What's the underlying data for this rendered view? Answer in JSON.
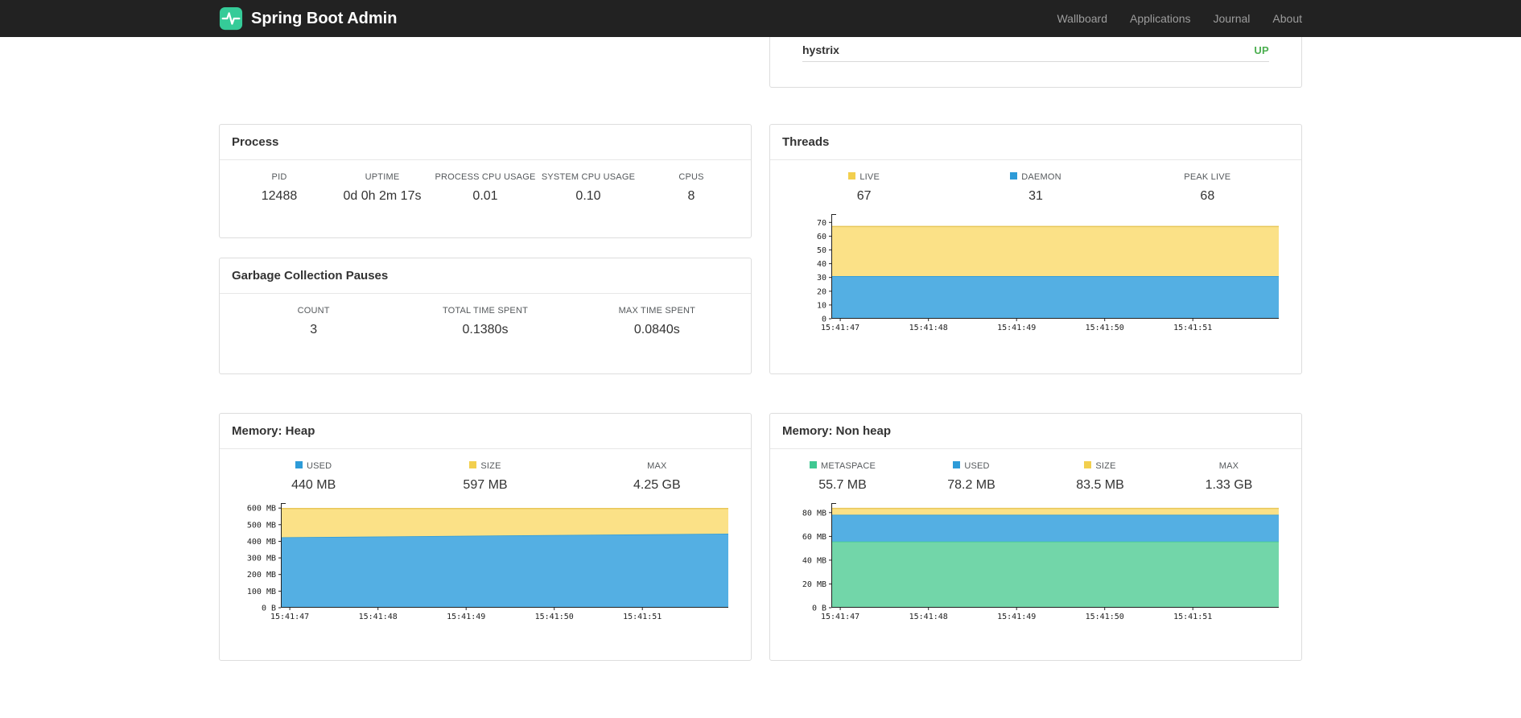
{
  "navbar": {
    "brand": "Spring Boot Admin",
    "links": [
      {
        "label": "Wallboard"
      },
      {
        "label": "Applications"
      },
      {
        "label": "Journal"
      },
      {
        "label": "About"
      }
    ]
  },
  "application_card": {
    "name": "hystrix",
    "status": "UP",
    "status_color": "#4caf50"
  },
  "process": {
    "title": "Process",
    "metrics": [
      {
        "label": "PID",
        "value": "12488"
      },
      {
        "label": "UPTIME",
        "value": "0d 0h 2m 17s"
      },
      {
        "label": "PROCESS CPU USAGE",
        "value": "0.01"
      },
      {
        "label": "SYSTEM CPU USAGE",
        "value": "0.10"
      },
      {
        "label": "CPUS",
        "value": "8"
      }
    ]
  },
  "gc": {
    "title": "Garbage Collection Pauses",
    "metrics": [
      {
        "label": "COUNT",
        "value": "3"
      },
      {
        "label": "TOTAL TIME SPENT",
        "value": "0.1380s"
      },
      {
        "label": "MAX TIME SPENT",
        "value": "0.0840s"
      }
    ]
  },
  "threads": {
    "title": "Threads",
    "legend": [
      {
        "label": "LIVE",
        "value": "67",
        "swatch": "#f2cf4e"
      },
      {
        "label": "DAEMON",
        "value": "31",
        "swatch": "#2d9bd8"
      },
      {
        "label": "PEAK LIVE",
        "value": "68",
        "swatch": null
      }
    ]
  },
  "heap": {
    "title": "Memory: Heap",
    "legend": [
      {
        "label": "USED",
        "value": "440 MB",
        "swatch": "#2d9bd8"
      },
      {
        "label": "SIZE",
        "value": "597 MB",
        "swatch": "#f2cf4e"
      },
      {
        "label": "MAX",
        "value": "4.25 GB",
        "swatch": null
      }
    ]
  },
  "nonheap": {
    "title": "Memory: Non heap",
    "legend": [
      {
        "label": "METASPACE",
        "value": "55.7 MB",
        "swatch": "#3fc892"
      },
      {
        "label": "USED",
        "value": "78.2 MB",
        "swatch": "#2d9bd8"
      },
      {
        "label": "SIZE",
        "value": "83.5 MB",
        "swatch": "#f2cf4e"
      },
      {
        "label": "MAX",
        "value": "1.33 GB",
        "swatch": null
      }
    ]
  },
  "chart_data": [
    {
      "id": "threads",
      "type": "area",
      "title": "Threads",
      "x": [
        "15:41:47",
        "15:41:48",
        "15:41:49",
        "15:41:50",
        "15:41:51"
      ],
      "ylim": [
        0,
        76
      ],
      "yticks": [
        {
          "v": 0,
          "label": "0"
        },
        {
          "v": 10,
          "label": "10"
        },
        {
          "v": 20,
          "label": "20"
        },
        {
          "v": 30,
          "label": "30"
        },
        {
          "v": 40,
          "label": "40"
        },
        {
          "v": 50,
          "label": "50"
        },
        {
          "v": 60,
          "label": "60"
        },
        {
          "v": 70,
          "label": "70"
        }
      ],
      "series": [
        {
          "name": "DAEMON",
          "fill": "#54afe3",
          "stroke": "#2d9bd8",
          "cumulative": [
            31,
            31
          ]
        },
        {
          "name": "LIVE",
          "fill": "#fbe187",
          "stroke": "#e8c75a",
          "cumulative": [
            67,
            67
          ]
        }
      ]
    },
    {
      "id": "heap",
      "type": "area",
      "title": "Memory: Heap",
      "x": [
        "15:41:47",
        "15:41:48",
        "15:41:49",
        "15:41:50",
        "15:41:51"
      ],
      "ylim": [
        0,
        630
      ],
      "yticks": [
        {
          "v": 0,
          "label": "0 B"
        },
        {
          "v": 100,
          "label": "100 MB"
        },
        {
          "v": 200,
          "label": "200 MB"
        },
        {
          "v": 300,
          "label": "300 MB"
        },
        {
          "v": 400,
          "label": "400 MB"
        },
        {
          "v": 500,
          "label": "500 MB"
        },
        {
          "v": 600,
          "label": "600 MB"
        }
      ],
      "series": [
        {
          "name": "USED",
          "fill": "#54afe3",
          "stroke": "#2d9bd8",
          "cumulative": [
            424,
            446
          ]
        },
        {
          "name": "SIZE",
          "fill": "#fbe187",
          "stroke": "#e8c75a",
          "cumulative": [
            597,
            597
          ]
        }
      ]
    },
    {
      "id": "nonheap",
      "type": "area",
      "title": "Memory: Non heap",
      "x": [
        "15:41:47",
        "15:41:48",
        "15:41:49",
        "15:41:50",
        "15:41:51"
      ],
      "ylim": [
        0,
        88
      ],
      "yticks": [
        {
          "v": 0,
          "label": "0 B"
        },
        {
          "v": 20,
          "label": "20 MB"
        },
        {
          "v": 40,
          "label": "40 MB"
        },
        {
          "v": 60,
          "label": "60 MB"
        },
        {
          "v": 80,
          "label": "80 MB"
        }
      ],
      "series": [
        {
          "name": "METASPACE",
          "fill": "#72d6a9",
          "stroke": "#3fc892",
          "cumulative": [
            55.7,
            55.7
          ]
        },
        {
          "name": "USED",
          "fill": "#54afe3",
          "stroke": "#2d9bd8",
          "cumulative": [
            78.2,
            78.2
          ]
        },
        {
          "name": "SIZE",
          "fill": "#fbe187",
          "stroke": "#e8c75a",
          "cumulative": [
            83.5,
            83.5
          ]
        }
      ]
    }
  ]
}
